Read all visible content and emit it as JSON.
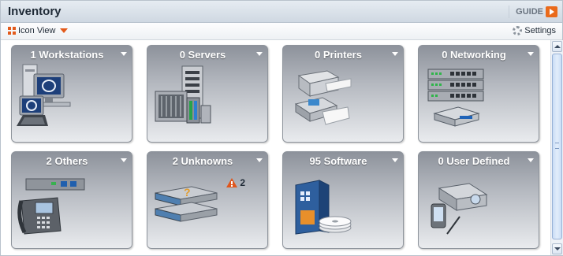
{
  "header": {
    "title": "Inventory",
    "guide_label": "GUIDE"
  },
  "toolbar": {
    "view_label": "Icon View",
    "settings_label": "Settings"
  },
  "tiles": [
    {
      "label": "1 Workstations",
      "icon": "workstations-icon"
    },
    {
      "label": "0 Servers",
      "icon": "servers-icon"
    },
    {
      "label": "0 Printers",
      "icon": "printer-icon"
    },
    {
      "label": "0 Networking",
      "icon": "network-switch-icon"
    },
    {
      "label": "2 Others",
      "icon": "ip-phone-icon"
    },
    {
      "label": "2 Unknowns",
      "icon": "unknown-device-icon",
      "alert_count": "2"
    },
    {
      "label": "95 Software",
      "icon": "software-box-icon"
    },
    {
      "label": "0 User Defined",
      "icon": "user-defined-device-icon"
    }
  ],
  "colors": {
    "accent": "#e35a1a",
    "tile_top": "#8d929b",
    "tile_bottom": "#e9ebee"
  }
}
